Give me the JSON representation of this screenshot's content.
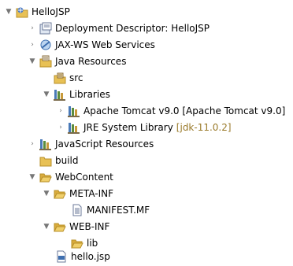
{
  "tree": {
    "project": {
      "label": "HelloJSP"
    },
    "deployment_descriptor": {
      "label": "Deployment Descriptor: HelloJSP"
    },
    "jaxws": {
      "label": "JAX-WS Web Services"
    },
    "java_resources": {
      "label": "Java Resources"
    },
    "src": {
      "label": "src"
    },
    "libraries": {
      "label": "Libraries"
    },
    "tomcat": {
      "label": "Apache Tomcat v9.0 [Apache Tomcat v9.0]"
    },
    "jre": {
      "label": "JRE System Library",
      "decoration": "[jdk-11.0.2]"
    },
    "js_resources": {
      "label": "JavaScript Resources"
    },
    "build": {
      "label": "build"
    },
    "webcontent": {
      "label": "WebContent"
    },
    "meta_inf": {
      "label": "META-INF"
    },
    "manifest": {
      "label": "MANIFEST.MF"
    },
    "web_inf": {
      "label": "WEB-INF"
    },
    "lib": {
      "label": "lib"
    },
    "hello_jsp": {
      "label": "hello.jsp"
    }
  },
  "colors": {
    "folder": "#e8c155",
    "folder_stroke": "#b8902a",
    "selection": "#d0e4f7",
    "decoration": "#9a7a2a"
  }
}
